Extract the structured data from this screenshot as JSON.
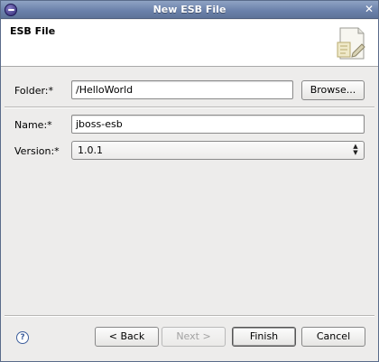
{
  "window": {
    "title": "New ESB File"
  },
  "header": {
    "title": "ESB File",
    "graphic_icon": "document-wizard-icon"
  },
  "form": {
    "folder_label": "Folder:*",
    "folder_value": "/HelloWorld",
    "browse_label": "Browse...",
    "name_label": "Name:*",
    "name_value": "jboss-esb",
    "version_label": "Version:*",
    "version_value": "1.0.1"
  },
  "buttons": {
    "help_icon": "help-icon",
    "back_label": "< Back",
    "next_label": "Next >",
    "finish_label": "Finish",
    "cancel_label": "Cancel"
  },
  "colors": {
    "titlebar": "#6c82ab",
    "dialog_bg": "#edeceb"
  }
}
